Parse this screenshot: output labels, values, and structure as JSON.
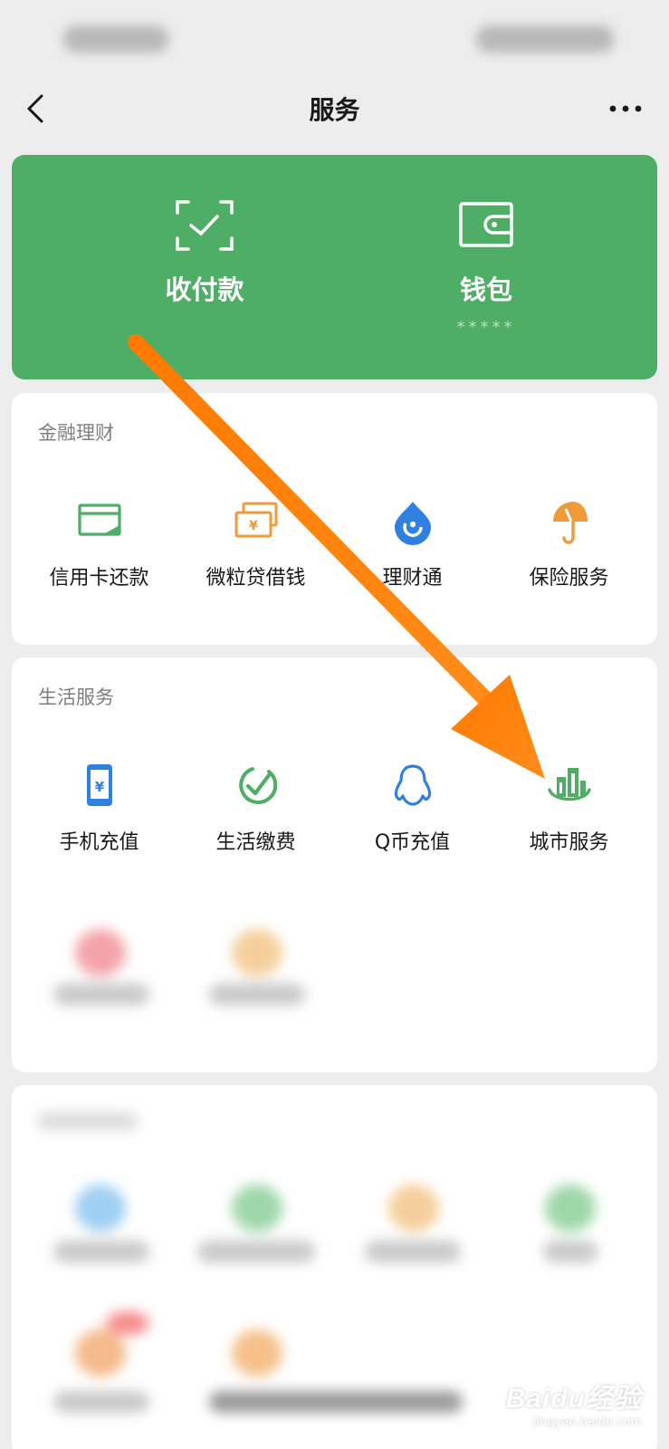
{
  "nav": {
    "title": "服务"
  },
  "pay_card": {
    "items": [
      {
        "label": "收付款",
        "icon": "scan-check-icon"
      },
      {
        "label": "钱包",
        "icon": "wallet-icon",
        "sub": "*****"
      }
    ],
    "color": "#4fae66"
  },
  "finance": {
    "title": "金融理财",
    "items": [
      {
        "label": "信用卡还款",
        "icon": "credit-card-icon",
        "color": "#4fae66"
      },
      {
        "label": "微粒贷借钱",
        "icon": "banknote-icon",
        "color": "#f09a3a"
      },
      {
        "label": "理财通",
        "icon": "wealth-drop-icon",
        "color": "#2f80e1"
      },
      {
        "label": "保险服务",
        "icon": "umbrella-icon",
        "color": "#f09a3a"
      }
    ]
  },
  "life": {
    "title": "生活服务",
    "items": [
      {
        "label": "手机充值",
        "icon": "phone-yuan-icon",
        "color": "#2f80e1"
      },
      {
        "label": "生活缴费",
        "icon": "check-circle-icon",
        "color": "#4fae66"
      },
      {
        "label": "Q币充值",
        "icon": "penguin-icon",
        "color": "#2f80e1"
      },
      {
        "label": "城市服务",
        "icon": "city-buildings-icon",
        "color": "#4fae66"
      }
    ]
  },
  "watermark": {
    "brand": "Baidu经验",
    "url": "jingyan.baidu.com"
  },
  "colors": {
    "background": "#ededed",
    "accent": "#4fae66",
    "arrow": "#ff8000"
  }
}
